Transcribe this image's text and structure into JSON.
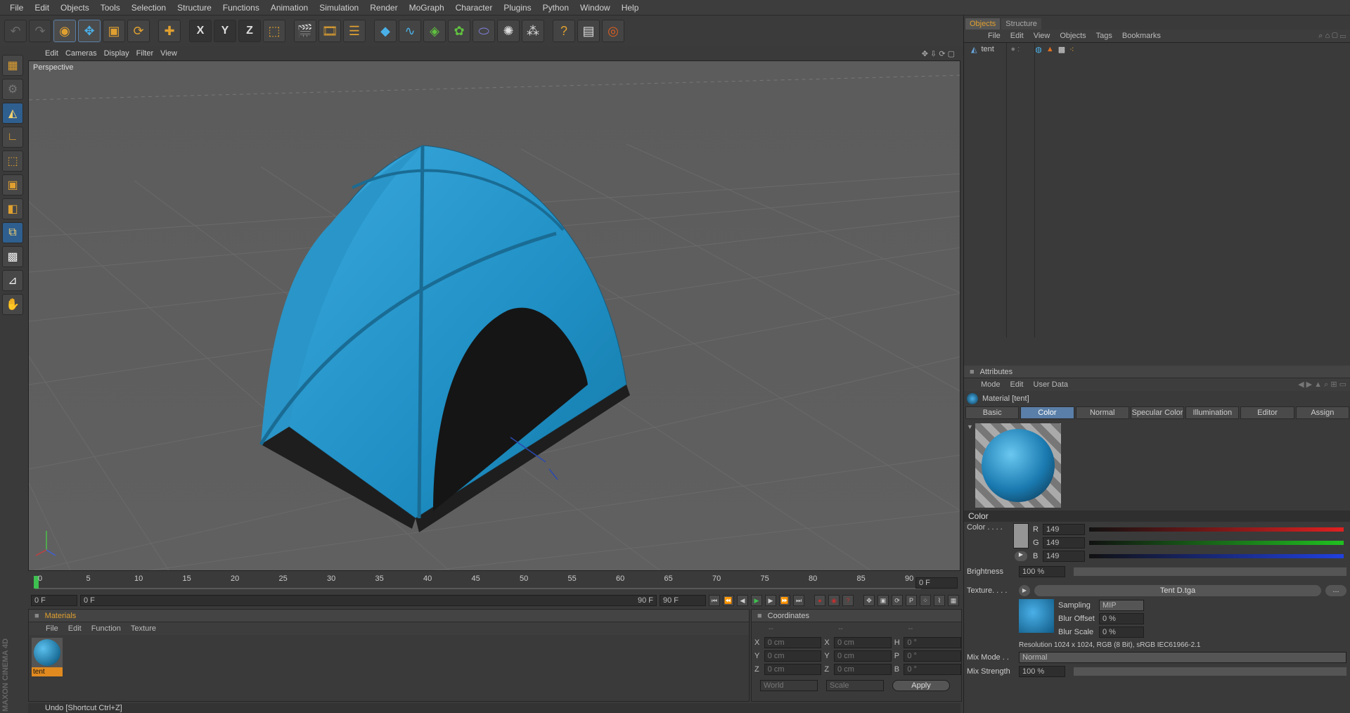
{
  "menubar": [
    "File",
    "Edit",
    "Objects",
    "Tools",
    "Selection",
    "Structure",
    "Functions",
    "Animation",
    "Simulation",
    "Render",
    "MoGraph",
    "Character",
    "Plugins",
    "Python",
    "Window",
    "Help"
  ],
  "toolbar": {
    "icons": [
      "undo-icon",
      "redo-icon",
      "live-selection-icon",
      "move-icon",
      "scale-icon",
      "rotate-icon",
      "add-icon",
      "x-axis-icon",
      "y-axis-icon",
      "z-axis-icon",
      "coordinate-system-icon",
      "render-view-icon",
      "render-picture-viewer-icon",
      "render-settings-icon",
      "cube-icon",
      "spline-icon",
      "nurbs-icon",
      "array-icon",
      "deformer-icon",
      "environment-icon",
      "particle-icon",
      "help-icon",
      "settings-icon",
      "render-region-icon"
    ],
    "axis_labels": {
      "x": "X",
      "y": "Y",
      "z": "Z"
    }
  },
  "viewport": {
    "menu": [
      "Edit",
      "Cameras",
      "Display",
      "Filter",
      "View"
    ],
    "label": "Perspective"
  },
  "timeline": {
    "ticks": [
      "0",
      "5",
      "10",
      "15",
      "20",
      "25",
      "30",
      "35",
      "40",
      "45",
      "50",
      "55",
      "60",
      "65",
      "70",
      "75",
      "80",
      "85",
      "90"
    ],
    "current_frame": "0 F",
    "start_field": "0 F",
    "range_start": "0 F",
    "range_end": "90 F",
    "end_field": "90 F"
  },
  "materials": {
    "title": "Materials",
    "menu": [
      "File",
      "Edit",
      "Function",
      "Texture"
    ],
    "items": [
      {
        "name": "tent"
      }
    ]
  },
  "coordinates": {
    "title": "Coordinates",
    "col_headers": [
      "--",
      "--",
      "--"
    ],
    "rows": [
      {
        "a": "X",
        "av": "0 cm",
        "b": "X",
        "bv": "0 cm",
        "c": "H",
        "cv": "0 °"
      },
      {
        "a": "Y",
        "av": "0 cm",
        "b": "Y",
        "bv": "0 cm",
        "c": "P",
        "cv": "0 °"
      },
      {
        "a": "Z",
        "av": "0 cm",
        "b": "Z",
        "bv": "0 cm",
        "c": "B",
        "cv": "0 °"
      }
    ],
    "world": "World",
    "scale": "Scale",
    "apply": "Apply"
  },
  "status": "Undo [Shortcut Ctrl+Z]",
  "branding": "MAXON CINEMA 4D",
  "objects_panel": {
    "tabs": [
      "Objects",
      "Structure"
    ],
    "menu": [
      "File",
      "Edit",
      "View",
      "Objects",
      "Tags",
      "Bookmarks"
    ],
    "items": [
      {
        "name": "tent"
      }
    ]
  },
  "attributes": {
    "title": "Attributes",
    "menu": [
      "Mode",
      "Edit",
      "User Data"
    ],
    "material_title": "Material [tent]",
    "tabs": [
      "Basic",
      "Color",
      "Normal",
      "Specular Color",
      "Illumination",
      "Editor",
      "Assign"
    ],
    "active_tab": "Color",
    "section": "Color",
    "color_label": "Color . . . .",
    "r": {
      "label": "R",
      "value": "149"
    },
    "g": {
      "label": "G",
      "value": "149"
    },
    "b": {
      "label": "B",
      "value": "149"
    },
    "brightness_label": "Brightness",
    "brightness": "100 %",
    "texture_label": "Texture. . . .",
    "texture_file": "Tent D.tga",
    "more_button": "...",
    "sampling_label": "Sampling",
    "sampling": "MIP",
    "blur_offset_label": "Blur Offset",
    "blur_offset": "0 %",
    "blur_scale_label": "Blur Scale",
    "blur_scale": "0 %",
    "resolution": "Resolution 1024 x 1024, RGB (8 Bit), sRGB IEC61966-2.1",
    "mix_mode_label": "Mix Mode . .",
    "mix_mode": "Normal",
    "mix_strength_label": "Mix Strength",
    "mix_strength": "100 %"
  },
  "colors": {
    "accent": "#e0a030",
    "tent": "#2a9fd0",
    "active_tab": "#5a7fa8"
  }
}
